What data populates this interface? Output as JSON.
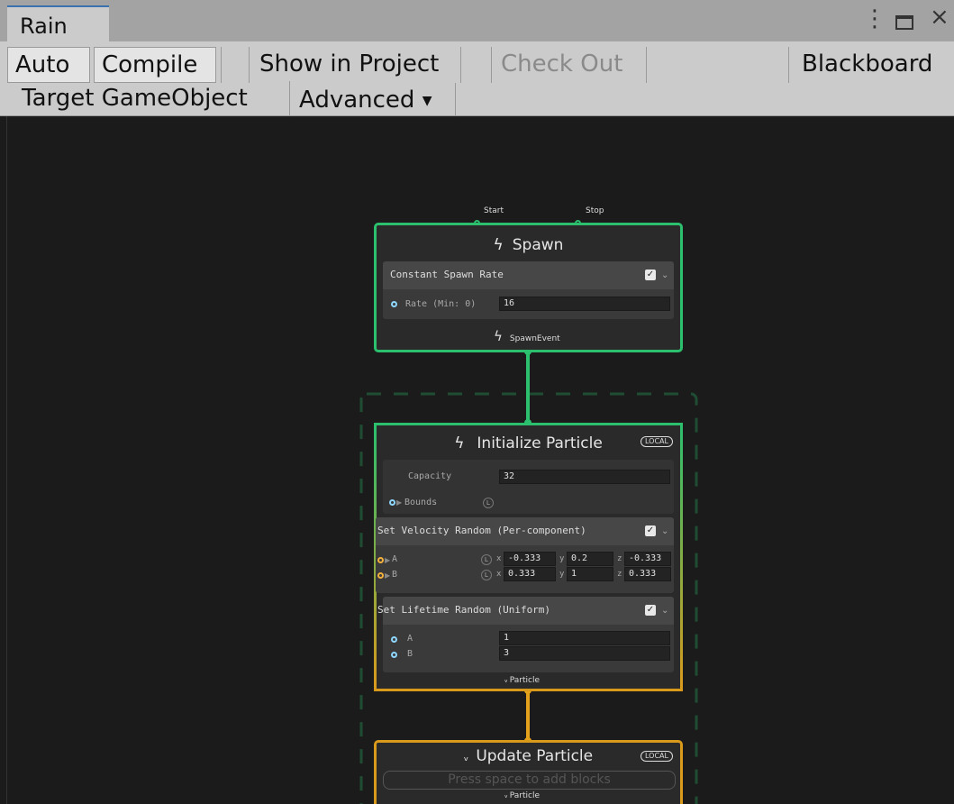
{
  "window": {
    "tab_title": "Rain",
    "menu_icon": "kebab-menu-icon",
    "maximize_icon": "maximize-icon",
    "close_icon": "close-icon"
  },
  "toolbar": {
    "auto_label": "Auto",
    "compile_label": "Compile",
    "show_in_project_label": "Show in Project",
    "check_out_label": "Check Out",
    "blackboard_label": "Blackboard",
    "target_label": "Target GameObject",
    "advanced_label": "Advanced"
  },
  "colors": {
    "spawn_border": "#2bbf6e",
    "particle_border": "#d99a1c",
    "wire_spawn": "#2bbf6e",
    "wire_particle": "#e4a11b"
  },
  "spawn_node": {
    "start_label": "Start",
    "stop_label": "Stop",
    "title": "Spawn",
    "title_icon": "lightning-icon",
    "block_title": "Constant Spawn Rate",
    "rate_label": "Rate (Min: 0)",
    "rate_value": "16",
    "output_label": "SpawnEvent"
  },
  "init_node": {
    "title": "Initialize Particle",
    "title_icon": "lightning-icon",
    "badge": "LOCAL",
    "capacity_label": "Capacity",
    "capacity_value": "32",
    "bounds_label": "Bounds",
    "velocity_block_title": "Set Velocity Random (Per-component)",
    "vel_a_label": "A",
    "vel_a_x": "-0.333",
    "vel_a_y": "0.2",
    "vel_a_z": "-0.333",
    "vel_b_label": "B",
    "vel_b_x": "0.333",
    "vel_b_y": "1",
    "vel_b_z": "0.333",
    "axis_x": "x",
    "axis_y": "y",
    "axis_z": "z",
    "local_space_glyph": "L",
    "lifetime_block_title": "Set Lifetime Random (Uniform)",
    "life_a_label": "A",
    "life_a_value": "1",
    "life_b_label": "B",
    "life_b_value": "3",
    "output_label": "Particle"
  },
  "update_node": {
    "title": "Update Particle",
    "title_icon": "particle-icon",
    "badge": "LOCAL",
    "placeholder": "Press space to add blocks",
    "output_label": "Particle"
  }
}
